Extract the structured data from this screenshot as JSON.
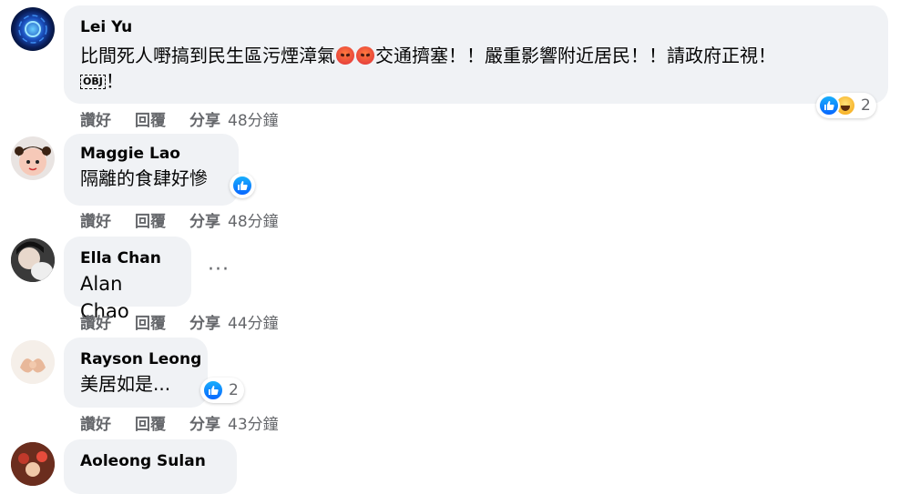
{
  "comments": [
    {
      "name": "Lei Yu",
      "text_part1": "比間死人嘢搞到民生區污煙漳氣",
      "text_part2": "交通擠塞！！嚴重影響附近居民！！請政府正視！",
      "text_obj": "OBJ",
      "text_end": "！",
      "actions": {
        "like": "讚好",
        "reply": "回覆",
        "share": "分享",
        "time": "48分鐘"
      },
      "reactions": {
        "icons": [
          "like-icon",
          "haha-icon"
        ],
        "count": "2"
      },
      "emoji": "angry-face-icon"
    },
    {
      "name": "Maggie Lao",
      "text": "隔離的食肆好慘",
      "actions": {
        "like": "讚好",
        "reply": "回覆",
        "share": "分享",
        "time": "48分鐘"
      },
      "reactions": {
        "icons": [
          "like-icon"
        ],
        "count": ""
      }
    },
    {
      "name": "Ella Chan",
      "tag": "Alan Chao",
      "more": "···",
      "actions": {
        "like": "讚好",
        "reply": "回覆",
        "share": "分享",
        "time": "44分鐘"
      }
    },
    {
      "name": "Rayson Leong",
      "text": "美居如是...",
      "actions": {
        "like": "讚好",
        "reply": "回覆",
        "share": "分享",
        "time": "43分鐘"
      },
      "reactions": {
        "icons": [
          "like-icon"
        ],
        "count": "2"
      }
    },
    {
      "name": "Aoleong Sulan"
    }
  ],
  "colors": {
    "bubble": "#f0f2f5",
    "meta": "#65676b",
    "like": "#0866ff",
    "text": "#050505"
  }
}
